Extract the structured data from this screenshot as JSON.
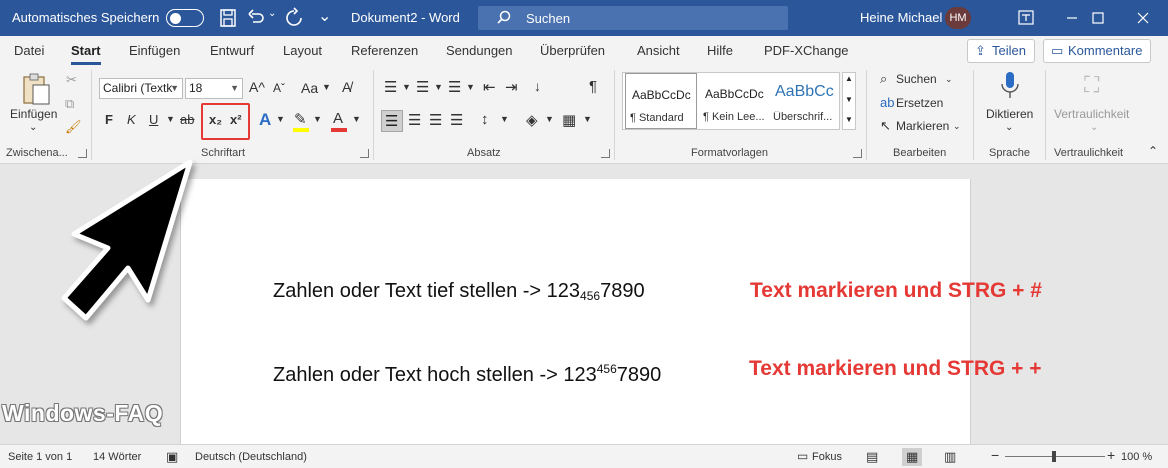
{
  "titlebar": {
    "autosave_label": "Automatisches Speichern",
    "doc_title": "Dokument2  -  Word",
    "search_label": "Suchen",
    "user_name": "Heine Michael",
    "user_initials": "HM"
  },
  "tabs": [
    "Datei",
    "Start",
    "Einfügen",
    "Entwurf",
    "Layout",
    "Referenzen",
    "Sendungen",
    "Überprüfen",
    "Ansicht",
    "Hilfe",
    "PDF-XChange"
  ],
  "active_tab": "Start",
  "header_buttons": {
    "share": "Teilen",
    "comments": "Kommentare"
  },
  "ribbon": {
    "clipboard": {
      "paste": "Einfügen",
      "label": "Zwischena..."
    },
    "font": {
      "family": "Calibri (Textk",
      "size": "18",
      "bold": "F",
      "italic": "K",
      "underline": "U",
      "strike": "ab",
      "subscript": "x₂",
      "superscript": "x²",
      "change_case": "Aa",
      "label": "Schriftart"
    },
    "paragraph": {
      "label": "Absatz"
    },
    "styles": {
      "items": [
        {
          "preview": "AaBbCcDc",
          "name": "¶ Standard"
        },
        {
          "preview": "AaBbCcDc",
          "name": "¶ Kein Lee..."
        },
        {
          "preview": "AaBbCc",
          "name": "Überschrif..."
        }
      ],
      "label": "Formatvorlagen"
    },
    "editing": {
      "find": "Suchen",
      "replace": "Ersetzen",
      "select": "Markieren",
      "label": "Bearbeiten"
    },
    "voice": {
      "dictate": "Diktieren",
      "label": "Sprache"
    },
    "sensitivity": {
      "button": "Vertraulichkeit",
      "label": "Vertraulichkeit"
    }
  },
  "document": {
    "line1": {
      "prefix": "Zahlen oder Text tief stellen -> 123",
      "script": "456",
      "suffix": "7890"
    },
    "line2": {
      "prefix": "Zahlen oder Text hoch stellen -> 123",
      "script": "456",
      "suffix": "7890"
    },
    "annotation1": "Text markieren und STRG + #",
    "annotation2": "Text markieren und STRG + +"
  },
  "watermark": "Windows-FAQ",
  "status": {
    "page": "Seite 1 von 1",
    "words": "14 Wörter",
    "language": "Deutsch (Deutschland)",
    "focus": "Fokus",
    "zoom": "100 %"
  },
  "colors": {
    "title_bar": "#2b579a",
    "annotation": "#e53935",
    "highlight_box": "#e53935"
  }
}
